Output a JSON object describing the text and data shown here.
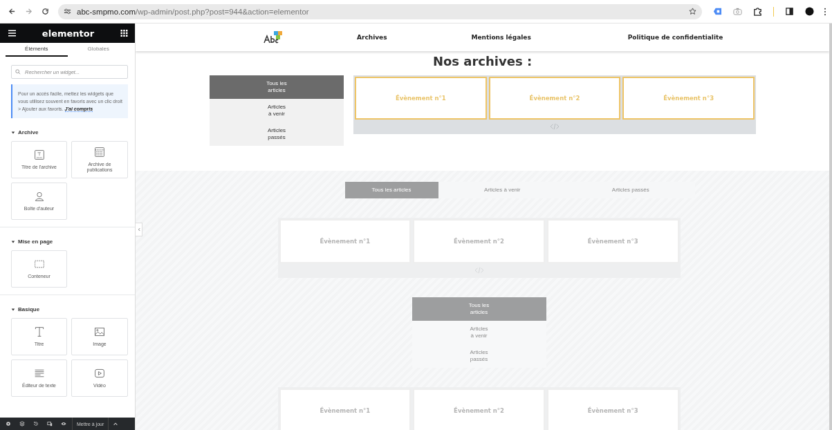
{
  "browser": {
    "url_host": "abc-smpmo.com",
    "url_path": "/wp-admin/post.php?post=944&action=elementor"
  },
  "panel": {
    "title": "elementor",
    "tabs": [
      {
        "label": "Éléments",
        "selected": true
      },
      {
        "label": "Globales",
        "selected": false
      }
    ],
    "search": {
      "placeholder": "Rechercher un widget..."
    },
    "notice": {
      "text": "Pour un accès facile, mettez les widgets que vous utilisez souvent en favoris avec un clic droit > Ajouter aux favoris.",
      "link": "J'ai compris"
    },
    "categories": [
      {
        "title": "Archive",
        "expanded": true,
        "widgets": [
          {
            "label": "Titre de l'archive",
            "kind": "archive-title"
          },
          {
            "label": "Archive de publications",
            "kind": "posts"
          },
          {
            "label": "Boîte d'auteur",
            "kind": "author"
          }
        ]
      },
      {
        "title": "Mise en page",
        "expanded": true,
        "widgets": [
          {
            "label": "Conteneur",
            "kind": "container"
          }
        ]
      },
      {
        "title": "Basique",
        "expanded": true,
        "widgets": [
          {
            "label": "Titre",
            "kind": "heading"
          },
          {
            "label": "Image",
            "kind": "image"
          },
          {
            "label": "Éditeur de texte",
            "kind": "text"
          },
          {
            "label": "Vidéo",
            "kind": "video"
          }
        ]
      }
    ],
    "footer": {
      "button": "Mettre à jour"
    }
  },
  "site": {
    "nav": [
      "Archives",
      "Mentions légales",
      "Politique de confidentialite"
    ],
    "heading": "Nos archives :",
    "sections": [
      {
        "kind": "vertical",
        "dimmed": false,
        "highlighted": true,
        "tabs": [
          {
            "label": "Tous les\narticles",
            "selected": true
          },
          {
            "label": "Articles\nà venir",
            "selected": false
          },
          {
            "label": "Articles\npassés",
            "selected": false
          }
        ],
        "events": [
          "Évènement n°1",
          "Évènement n°2",
          "Évènement n°3"
        ]
      },
      {
        "kind": "horizontal",
        "dimmed": true,
        "highlighted": false,
        "tabs": [
          {
            "label": "Tous les articles",
            "selected": true
          },
          {
            "label": "Articles à venir",
            "selected": false
          },
          {
            "label": "Articles passés",
            "selected": false
          }
        ],
        "events": [
          "Évènement n°1",
          "Évènement n°2",
          "Évènement n°3"
        ]
      },
      {
        "kind": "vertical",
        "dimmed": true,
        "highlighted": false,
        "tabs": [
          {
            "label": "Tous les\narticles",
            "selected": true
          },
          {
            "label": "Articles\nà venir",
            "selected": false
          },
          {
            "label": "Articles\npassés",
            "selected": false
          }
        ],
        "events": [
          "Évènement n°1",
          "Évènement n°2",
          "Évènement n°3"
        ]
      }
    ]
  }
}
